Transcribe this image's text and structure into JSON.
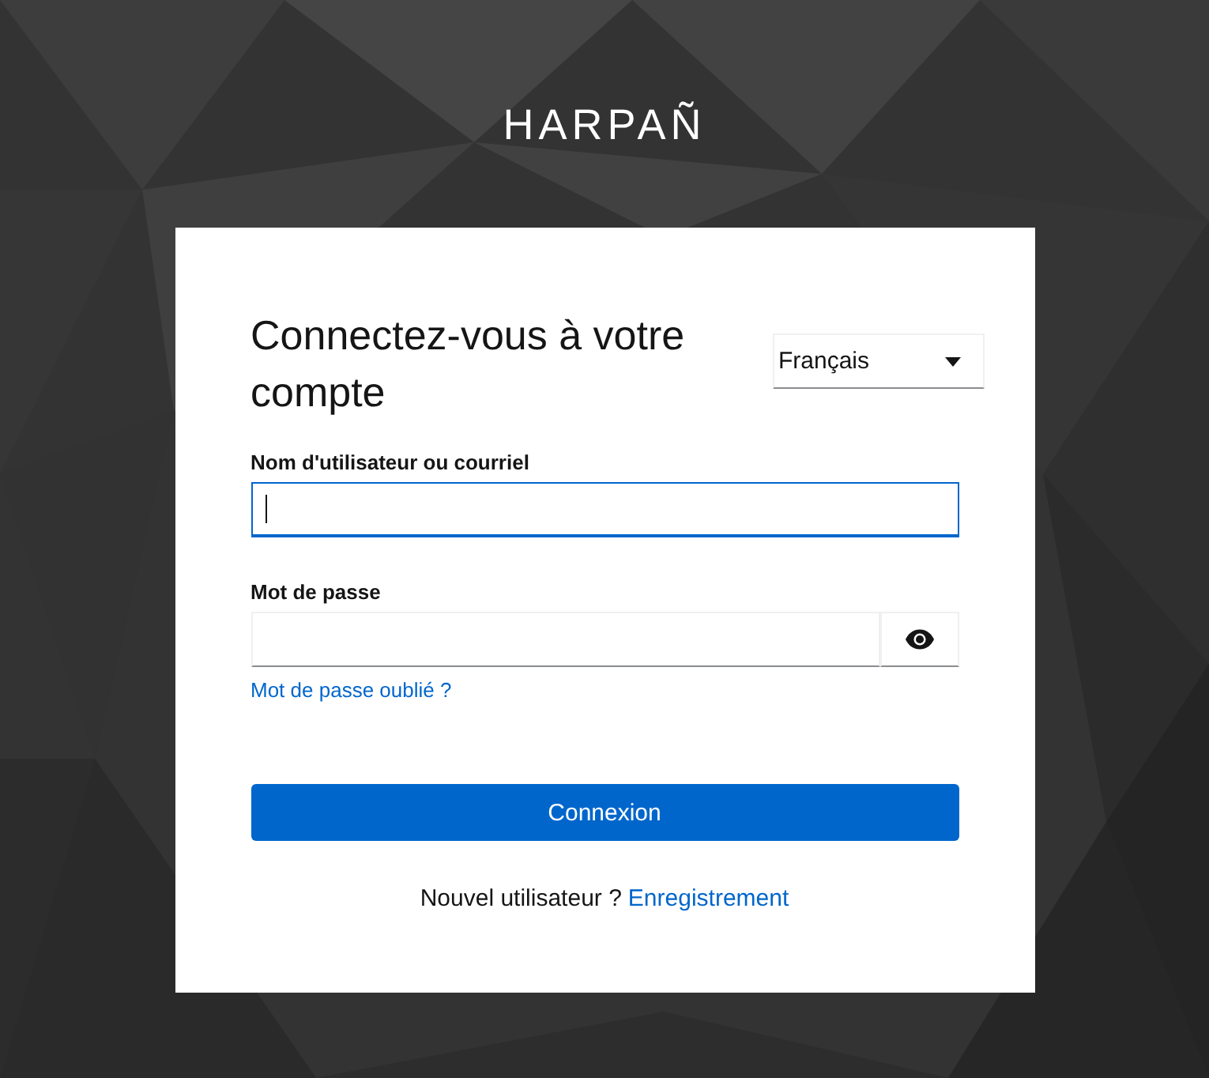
{
  "brand": {
    "name": "HARPAÑ"
  },
  "heading": "Connectez-vous à votre compte",
  "language_select": {
    "value": "Français"
  },
  "fields": [
    {
      "kind": "text",
      "label": "Nom d'utilisateur ou courriel",
      "focused": true
    },
    {
      "kind": "password",
      "label": "Mot de passe",
      "focused": false
    }
  ],
  "forgot_link": "Mot de passe oublié ?",
  "submit_button": "Connexion",
  "register": {
    "prompt": "Nouvel utilisateur ?",
    "link": "Enregistrement"
  }
}
